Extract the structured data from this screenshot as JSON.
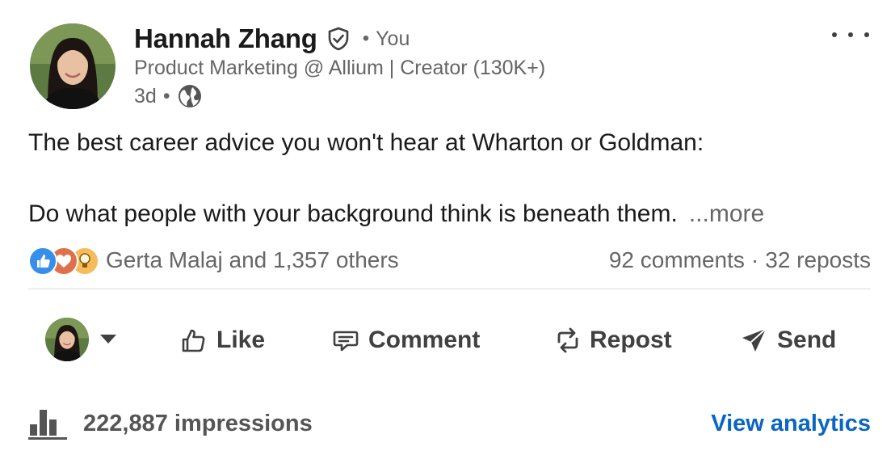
{
  "author": {
    "name": "Hannah Zhang",
    "relation": "You",
    "headline": "Product Marketing @ Allium | Creator (130K+)",
    "time": "3d",
    "visibility_icon": "globe-icon",
    "verified_icon": "verified-shield-icon"
  },
  "post": {
    "line1": "The best career advice you won't hear at Wharton or Goldman:",
    "line2": "Do what people with your background think is beneath them.",
    "more_label": "...more"
  },
  "social": {
    "reactions": [
      "like",
      "love",
      "insightful"
    ],
    "reactors_text": "Gerta Malaj and 1,357 others",
    "comments": "92 comments",
    "reposts": "32 reposts"
  },
  "actions": [
    {
      "label": "Like",
      "icon": "thumbs-up-icon"
    },
    {
      "label": "Comment",
      "icon": "comment-icon"
    },
    {
      "label": "Repost",
      "icon": "repost-icon"
    },
    {
      "label": "Send",
      "icon": "send-icon"
    }
  ],
  "analytics": {
    "impressions": "222,887 impressions",
    "view_label": "View analytics"
  },
  "colors": {
    "link_blue": "#0a66c2",
    "like_blue": "#378fe9",
    "love_red": "#df704d",
    "insight_yellow": "#f5bb5c",
    "muted_text": "#666666"
  }
}
